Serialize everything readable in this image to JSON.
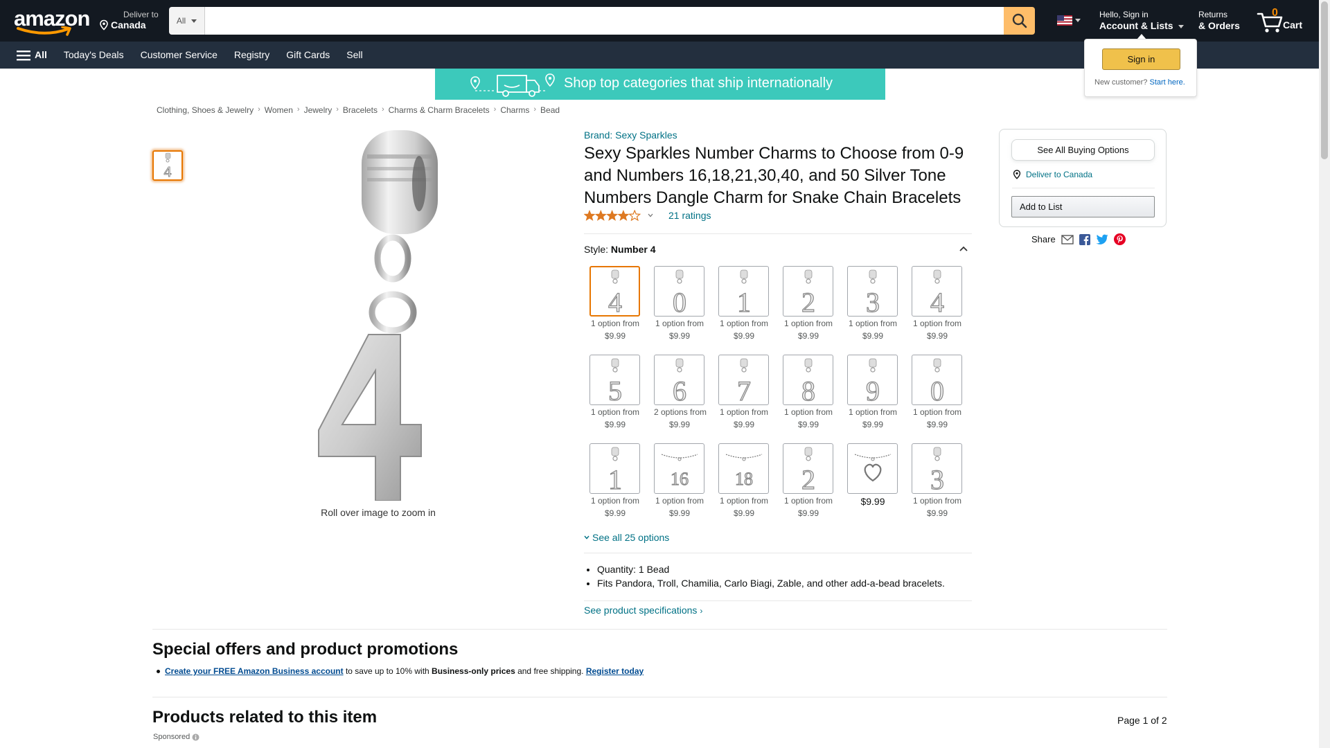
{
  "header": {
    "logo_text": "amazon",
    "deliver_line1": "Deliver to",
    "deliver_line2": "Canada",
    "search_category": "All",
    "search_placeholder": "",
    "account_line1": "Hello, Sign in",
    "account_line2": "Account & Lists",
    "returns_line1": "Returns",
    "returns_line2": "& Orders",
    "cart_count": "0",
    "cart_label": "Cart",
    "accent_color": "#febd69",
    "nav_bg": "#131921"
  },
  "subnav": {
    "all_label": "All",
    "items": [
      "Today's Deals",
      "Customer Service",
      "Registry",
      "Gift Cards",
      "Sell"
    ]
  },
  "signin_flyout": {
    "button_label": "Sign in",
    "new_customer": "New customer?",
    "start_here": "Start here."
  },
  "banner": {
    "text": "Shop top categories that ship internationally"
  },
  "breadcrumb": [
    "Clothing, Shoes & Jewelry",
    "Women",
    "Jewelry",
    "Bracelets",
    "Charms & Charm Bracelets",
    "Charms",
    "Bead"
  ],
  "image": {
    "zoom_hint": "Roll over image to zoom in"
  },
  "product": {
    "brand": "Brand: Sexy Sparkles",
    "title": "Sexy Sparkles Number Charms to Choose from 0-9 and Numbers 16,18,21,30,40, and 50 Silver Tone Numbers Dangle Charm for Snake Chain Bracelets",
    "rating": 4.0,
    "ratings_count": "21 ratings",
    "style_label": "Style:",
    "style_value": "Number 4",
    "swatches": [
      {
        "glyph": "4",
        "option": "1 option from",
        "price": "$9.99",
        "selected": true
      },
      {
        "glyph": "0",
        "option": "1 option from",
        "price": "$9.99"
      },
      {
        "glyph": "1",
        "option": "1 option from",
        "price": "$9.99"
      },
      {
        "glyph": "2",
        "option": "1 option from",
        "price": "$9.99"
      },
      {
        "glyph": "3",
        "option": "1 option from",
        "price": "$9.99"
      },
      {
        "glyph": "4",
        "option": "1 option from",
        "price": "$9.99"
      },
      {
        "glyph": "5",
        "option": "1 option from",
        "price": "$9.99"
      },
      {
        "glyph": "6",
        "option": "2 options from",
        "price": "$9.99"
      },
      {
        "glyph": "7",
        "option": "1 option from",
        "price": "$9.99"
      },
      {
        "glyph": "8",
        "option": "1 option from",
        "price": "$9.99"
      },
      {
        "glyph": "9",
        "option": "1 option from",
        "price": "$9.99"
      },
      {
        "glyph": "0",
        "option": "1 option from",
        "price": "$9.99"
      },
      {
        "glyph": "1",
        "option": "1 option from",
        "price": "$9.99"
      },
      {
        "glyph": "16",
        "option": "1 option from",
        "price": "$9.99"
      },
      {
        "glyph": "18",
        "option": "1 option from",
        "price": "$9.99"
      },
      {
        "glyph": "2",
        "option": "1 option from",
        "price": "$9.99"
      },
      {
        "glyph": "heart",
        "option": "",
        "price": "$9.99",
        "big": true
      },
      {
        "glyph": "3",
        "option": "1 option from",
        "price": "$9.99"
      }
    ],
    "see_all": "See all 25 options",
    "bullets": [
      "Quantity: 1 Bead",
      "Fits Pandora, Troll, Chamilia, Carlo Biagi, Zable, and other add-a-bead bracelets."
    ],
    "specs_link": "See product specifications"
  },
  "buybox": {
    "see_all_buying": "See All Buying Options",
    "deliver": "Deliver to Canada",
    "add_to_list": "Add to List",
    "share": "Share"
  },
  "offers": {
    "heading": "Special offers and product promotions",
    "link1": "Create your FREE Amazon Business account",
    "text1": " to save up to 10% with ",
    "bold": "Business-only prices",
    "text2": " and free shipping. ",
    "link2": "Register today"
  },
  "related": {
    "heading": "Products related to this item",
    "page": "Page 1 of 2",
    "sponsored": "Sponsored"
  }
}
